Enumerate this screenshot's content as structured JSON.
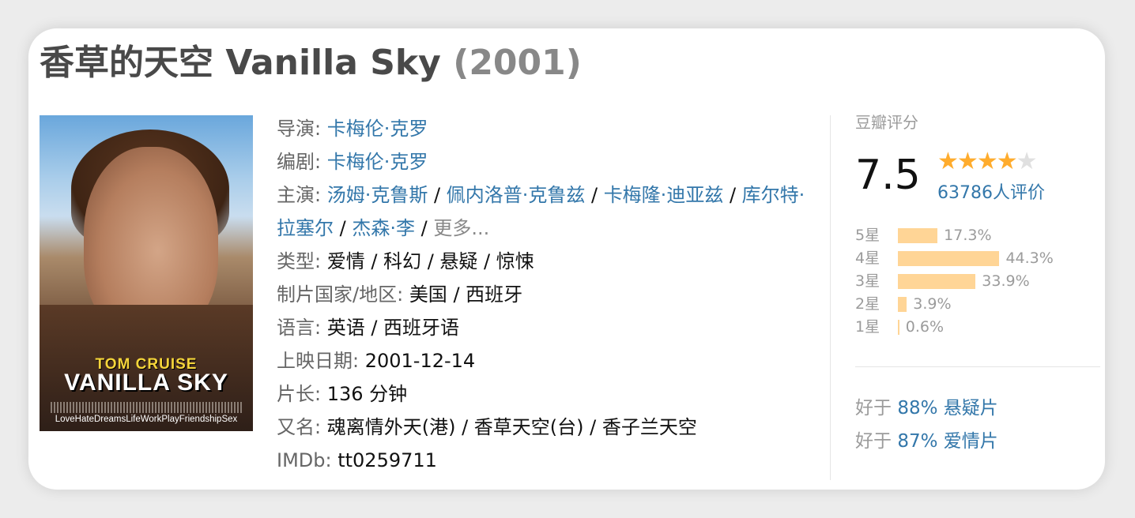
{
  "title": {
    "name": "香草的天空 Vanilla Sky",
    "year": "(2001)"
  },
  "poster": {
    "actor": "TOM CRUISE",
    "title": "VANILLA SKY",
    "tagline": "LoveHateDreamsLifeWorkPlayFriendshipSex"
  },
  "info": {
    "director": {
      "label": "导演",
      "value": "卡梅伦·克罗"
    },
    "writer": {
      "label": "编剧",
      "value": "卡梅伦·克罗"
    },
    "cast": {
      "label": "主演",
      "names": [
        "汤姆·克鲁斯",
        "佩内洛普·克鲁兹",
        "卡梅隆·迪亚兹",
        "库尔特·拉塞尔",
        "杰森·李"
      ],
      "more": "更多..."
    },
    "genre": {
      "label": "类型",
      "value": "爱情 / 科幻 / 悬疑 / 惊悚"
    },
    "country": {
      "label": "制片国家/地区",
      "value": "美国 / 西班牙"
    },
    "language": {
      "label": "语言",
      "value": "英语 / 西班牙语"
    },
    "release": {
      "label": "上映日期",
      "value": "2001-12-14"
    },
    "runtime": {
      "label": "片长",
      "value": "136 分钟"
    },
    "aka": {
      "label": "又名",
      "value": "魂离情外天(港) / 香草天空(台) / 香子兰天空"
    },
    "imdb": {
      "label": "IMDb",
      "value": "tt0259711"
    }
  },
  "rating": {
    "label": "豆瓣评分",
    "score": "7.5",
    "stars_filled": 4,
    "stars_total": 5,
    "votes": "63786人评价",
    "distribution": [
      {
        "label": "5星",
        "percent": 17.3,
        "text": "17.3%"
      },
      {
        "label": "4星",
        "percent": 44.3,
        "text": "44.3%"
      },
      {
        "label": "3星",
        "percent": 33.9,
        "text": "33.9%"
      },
      {
        "label": "2星",
        "percent": 3.9,
        "text": "3.9%"
      },
      {
        "label": "1星",
        "percent": 0.6,
        "text": "0.6%"
      }
    ],
    "better_than": [
      {
        "prefix": "好于",
        "value": "88% 悬疑片"
      },
      {
        "prefix": "好于",
        "value": "87% 爱情片"
      }
    ]
  },
  "colors": {
    "link": "#3377aa",
    "bar": "#ffd596",
    "star": "#ffac2d"
  }
}
